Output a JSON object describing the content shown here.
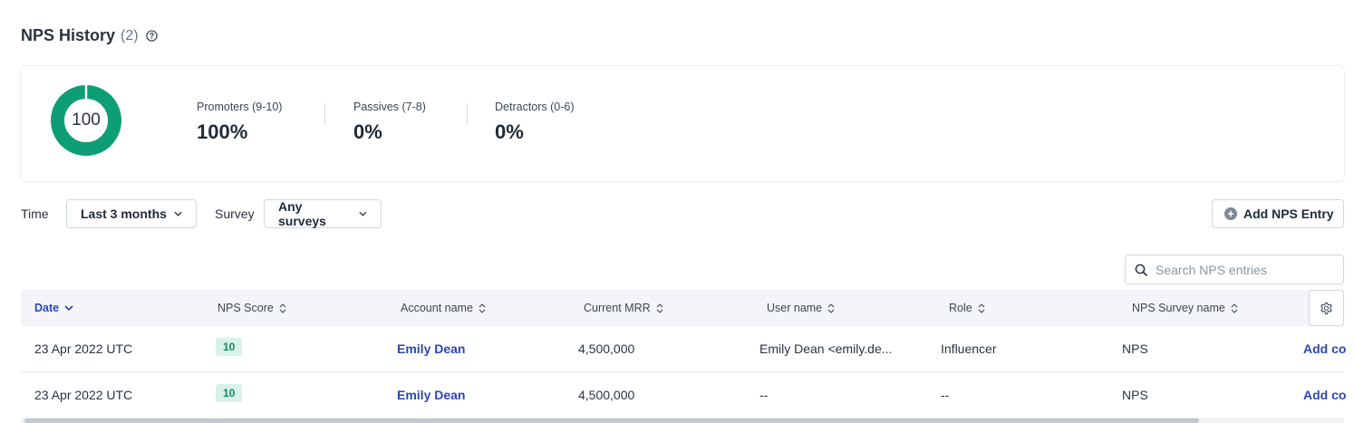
{
  "header": {
    "title": "NPS History",
    "count": "(2)"
  },
  "summary": {
    "score": "100",
    "promoter_fraction": 1.0,
    "colors": {
      "promoter": "#0e9e75",
      "gap": "#ffffff"
    },
    "metrics": [
      {
        "label": "Promoters (9-10)",
        "value": "100%"
      },
      {
        "label": "Passives (7-8)",
        "value": "0%"
      },
      {
        "label": "Detractors (0-6)",
        "value": "0%"
      }
    ]
  },
  "filters": {
    "time_label": "Time",
    "time_value": "Last 3 months",
    "survey_label": "Survey",
    "survey_value": "Any surveys"
  },
  "toolbar": {
    "add_label": "Add NPS Entry"
  },
  "search": {
    "placeholder": "Search NPS entries"
  },
  "table": {
    "columns": [
      {
        "label": "Date",
        "sort": "desc",
        "active": true
      },
      {
        "label": "NPS Score",
        "sort": "none"
      },
      {
        "label": "Account name",
        "sort": "none"
      },
      {
        "label": "Current MRR",
        "sort": "none"
      },
      {
        "label": "User name",
        "sort": "none"
      },
      {
        "label": "Role",
        "sort": "none"
      },
      {
        "label": "NPS Survey name",
        "sort": "none"
      }
    ],
    "rows": [
      {
        "date": "23 Apr 2022 UTC",
        "score": "10",
        "account": "Emily Dean",
        "mrr": "4,500,000",
        "user": "Emily Dean <emily.de...",
        "role": "Influencer",
        "survey": "NPS",
        "action": "Add co"
      },
      {
        "date": "23 Apr 2022 UTC",
        "score": "10",
        "account": "Emily Dean",
        "mrr": "4,500,000",
        "user": "--",
        "role": "--",
        "survey": "NPS",
        "action": "Add co"
      }
    ]
  }
}
